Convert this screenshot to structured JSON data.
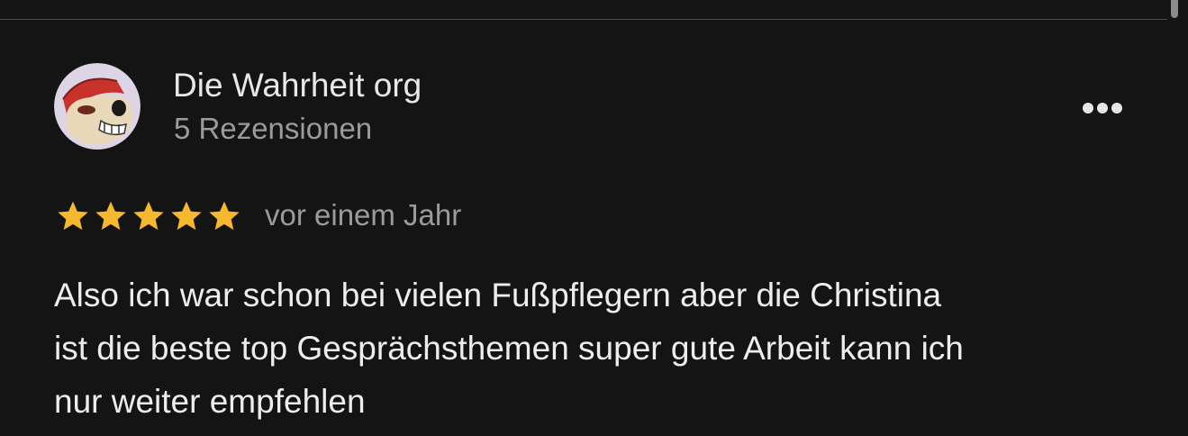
{
  "review": {
    "author_name": "Die Wahrheit org",
    "review_count": "5 Rezensionen",
    "rating": 5,
    "rating_max": 5,
    "date": "vor einem Jahr",
    "text_lines": [
      "Also ich war schon bei vielen Fußpflegern aber die Christina",
      "ist die beste top Gesprächsthemen super gute Arbeit kann ich",
      "nur weiter empfehlen"
    ]
  },
  "icons": {
    "more": "more-horizontal-icon",
    "star": "star-icon"
  },
  "colors": {
    "background": "#141414",
    "star": "#f5b82e",
    "primary_text": "#ededed",
    "secondary_text": "#9b9b9b"
  }
}
